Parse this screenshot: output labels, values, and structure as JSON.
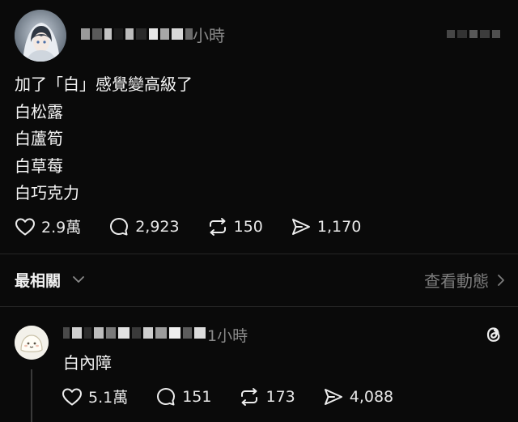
{
  "post": {
    "time": "小時",
    "lines": [
      "加了「白」感覺變高級了",
      "白松露",
      "白蘆筍",
      "白草莓",
      "白巧克力"
    ],
    "stats": {
      "likes": "2.9萬",
      "comments": "2,923",
      "reposts": "150",
      "shares": "1,170"
    }
  },
  "sort": {
    "label": "最相關",
    "view_activity": "查看動態"
  },
  "reply": {
    "time": "1小時",
    "text": "白內障",
    "stats": {
      "likes": "5.1萬",
      "comments": "151",
      "reposts": "173",
      "shares": "4,088"
    }
  },
  "colors": {
    "background": "#0a0a0a",
    "text": "#f2f2f2",
    "muted": "#8a8a8a",
    "divider": "#262626"
  },
  "icons": [
    "heart-icon",
    "comment-icon",
    "repost-icon",
    "share-icon",
    "chevron-down-icon",
    "chevron-right-icon",
    "threads-logo-icon"
  ]
}
